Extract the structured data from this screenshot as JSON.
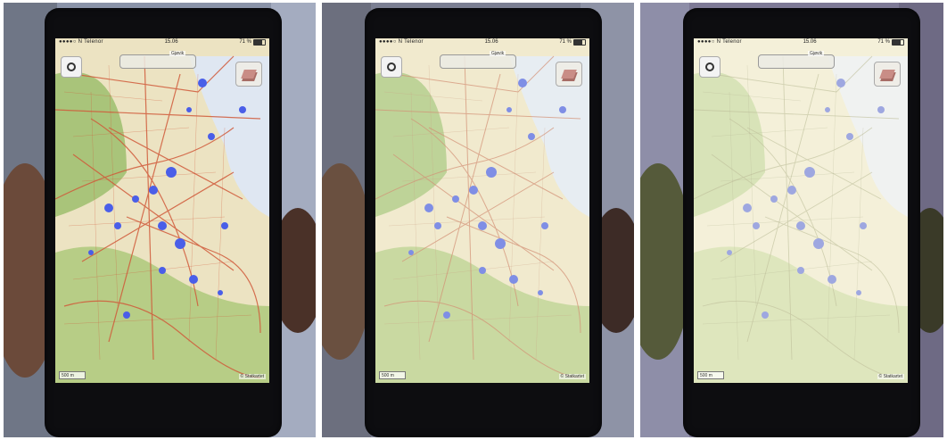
{
  "panels": [
    {
      "status": {
        "carrier": "●●●●○ N Telenor",
        "time": "15.06",
        "battery": "71 %",
        "battery_fraction": 0.71
      },
      "search": {
        "tag": "Gjøvik",
        "placeholder": ""
      },
      "scale": "500 m",
      "attribution": "© Statkartet",
      "brightness": "full"
    },
    {
      "status": {
        "carrier": "●●●●○ N Telenor",
        "time": "15.06",
        "battery": "71 %",
        "battery_fraction": 0.71
      },
      "search": {
        "tag": "Gjøvik",
        "placeholder": ""
      },
      "scale": "500 m",
      "attribution": "© Statkartet",
      "brightness": "medium"
    },
    {
      "status": {
        "carrier": "●●●●○ N Telenor",
        "time": "15.06",
        "battery": "71 %",
        "battery_fraction": 0.71
      },
      "search": {
        "tag": "Gjøvik",
        "placeholder": ""
      },
      "scale": "500 m",
      "attribution": "© Statkartet",
      "brightness": "washed-out"
    }
  ],
  "icons": {
    "settings": "gear-icon",
    "layers": "layers-icon",
    "wifi": "wifi-icon",
    "location": "location-arrow-icon"
  },
  "colors": {
    "road": "#d05a3a",
    "water": "#4a5ee8",
    "forest": "#a9c47a",
    "land": "#ece3c2"
  }
}
